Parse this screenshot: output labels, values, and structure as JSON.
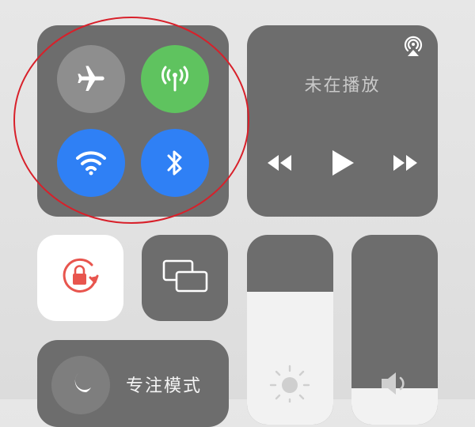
{
  "connectivity": {
    "airplane": {
      "icon": "airplane-icon",
      "state": "off",
      "color": "#8e8e8e"
    },
    "cellular": {
      "icon": "cellular-antenna-icon",
      "state": "on",
      "color": "#5fc35f"
    },
    "wifi": {
      "icon": "wifi-icon",
      "state": "on",
      "color": "#2f80f5"
    },
    "bluetooth": {
      "icon": "bluetooth-icon",
      "state": "on",
      "color": "#2f80f5"
    }
  },
  "media": {
    "status": "未在播放",
    "airplay_icon": "airplay-icon",
    "controls": [
      "rewind-icon",
      "play-icon",
      "fast-forward-icon"
    ]
  },
  "orientation_lock": {
    "icon": "rotation-lock-icon",
    "color": "#e8554e"
  },
  "screen_mirroring": {
    "icon": "screen-mirroring-icon"
  },
  "brightness": {
    "icon": "sun-icon",
    "level": 0.7
  },
  "volume": {
    "icon": "speaker-icon",
    "level": 0.19
  },
  "focus": {
    "label": "专注模式",
    "icon": "moon-icon"
  },
  "annotation": {
    "color": "#d8202a"
  }
}
